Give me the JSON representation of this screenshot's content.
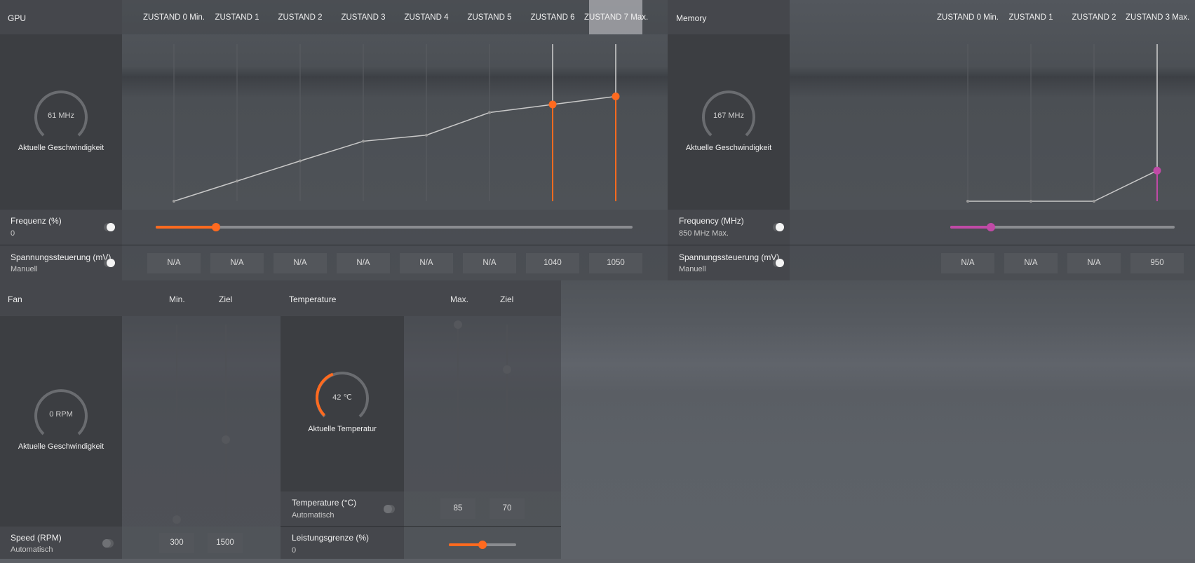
{
  "colors": {
    "accent_orange": "#ff6a1f",
    "accent_magenta": "#c04aa6",
    "panel": "#3c3e42",
    "curve": "#c9c9c9"
  },
  "gpu": {
    "title": "GPU",
    "states": [
      "ZUSTAND 0 Min.",
      "ZUSTAND 1",
      "ZUSTAND 2",
      "ZUSTAND 3",
      "ZUSTAND 4",
      "ZUSTAND 5",
      "ZUSTAND 6",
      "ZUSTAND 7 Max."
    ],
    "selected_state": 7,
    "gauge_value": "61 MHz",
    "gauge_caption": "Aktuelle Geschwindigkeit",
    "frequency_label": "Frequenz (%)",
    "frequency_value": "0",
    "frequency_slider_fraction": 0.127,
    "voltage_label": "Spannungssteuerung (mV)",
    "voltage_mode": "Manuell",
    "voltages": [
      "N/A",
      "N/A",
      "N/A",
      "N/A",
      "N/A",
      "N/A",
      "1040",
      "1050"
    ],
    "curve_levels": [
      0.0,
      0.125,
      0.25,
      0.372,
      0.41,
      0.55,
      0.6,
      0.65
    ],
    "highlighted_states": [
      6,
      7
    ]
  },
  "memory": {
    "title": "Memory",
    "states": [
      "ZUSTAND 0 Min.",
      "ZUSTAND 1",
      "ZUSTAND 2",
      "ZUSTAND 3 Max."
    ],
    "gauge_value": "167 MHz",
    "gauge_caption": "Aktuelle Geschwindigkeit",
    "frequency_label": "Frequency (MHz)",
    "frequency_value": "850 MHz Max.",
    "frequency_slider_fraction": 0.18,
    "voltage_label": "Spannungssteuerung (mV)",
    "voltage_mode": "Manuell",
    "voltages": [
      "N/A",
      "N/A",
      "N/A",
      "950"
    ],
    "curve_levels": [
      0.0,
      0.0,
      0.0,
      0.19
    ],
    "highlighted_states": [
      3
    ]
  },
  "fan": {
    "title": "Fan",
    "col_min": "Min.",
    "col_target": "Ziel",
    "gauge_value": "0 RPM",
    "gauge_caption": "Aktuelle Geschwindigkeit",
    "speed_label": "Speed (RPM)",
    "speed_mode": "Automatisch",
    "min_value": "300",
    "target_value": "1500",
    "min_level": 0.0,
    "target_level": 0.41
  },
  "temperature": {
    "title": "Temperature",
    "col_max": "Max.",
    "col_target": "Ziel",
    "gauge_value": "42 ℃",
    "gauge_caption": "Aktuelle Temperatur",
    "temp_label": "Temperature (°C)",
    "temp_mode": "Automatisch",
    "max_value": "85",
    "target_value": "70",
    "max_level": 1.0,
    "target_level": 0.72,
    "gauge_fill_fraction": 0.42,
    "power_label": "Leistungsgrenze (%)",
    "power_value": "0",
    "power_slider_fraction": 0.5
  }
}
